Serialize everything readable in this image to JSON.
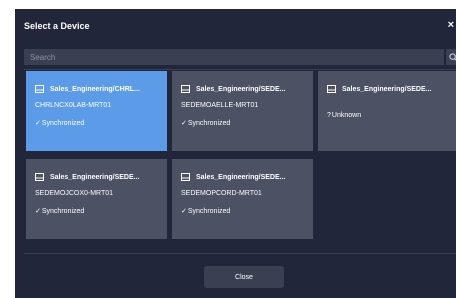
{
  "dialog": {
    "title": "Select a Device",
    "close_glyph": "×",
    "search_placeholder": "Search",
    "search_icon": "search-icon",
    "close_button_label": "Close"
  },
  "devices": [
    {
      "group": "Sales_Engineering/CHRL...",
      "name": "CHRLNCX0LAB-MRT01",
      "status_symbol": "✓",
      "status": "Synchronized",
      "selected": true
    },
    {
      "group": "Sales_Engineering/SEDE...",
      "name": "SEDEMOAELLE-MRT01",
      "status_symbol": "✓",
      "status": "Synchronized",
      "selected": false
    },
    {
      "group": "Sales_Engineering/SEDE...",
      "name": "",
      "status_symbol": "?",
      "status": "Unknown",
      "selected": false
    },
    {
      "group": "Sales_Engineering/SEDE...",
      "name": "SEDEMOJCOX0-MRT01",
      "status_symbol": "✓",
      "status": "Synchronized",
      "selected": false
    },
    {
      "group": "Sales_Engineering/SEDE...",
      "name": "SEDEMOPCORD-MRT01",
      "status_symbol": "✓",
      "status": "Synchronized",
      "selected": false
    }
  ],
  "colors": {
    "dialog_bg": "#22263a",
    "card_bg": "#4c5164",
    "card_selected_bg": "#5b9be8",
    "input_bg": "#3b3f52"
  }
}
